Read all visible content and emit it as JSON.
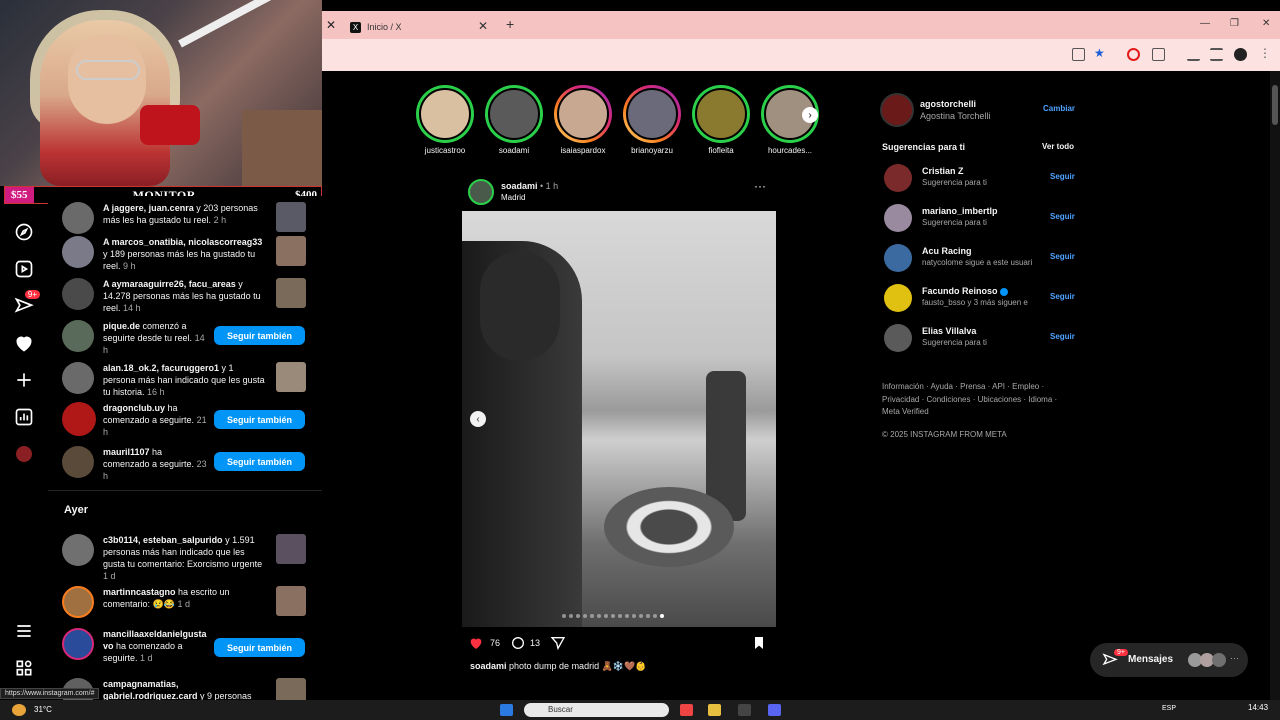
{
  "overlay": {
    "left_price": "$55",
    "title": "MONITOR",
    "right_price": "$400"
  },
  "nav_badge": "9+",
  "notifications": [
    {
      "user": "A jaggere, juan.cenra",
      "text": " y 203 personas más les ha gustado tu reel.",
      "time": " 2 h"
    },
    {
      "user": "A marcos_onatibia, nicolascorreag33",
      "text": " y 189 personas más les ha gustado tu reel.",
      "time": " 9 h"
    },
    {
      "user": "A aymaraaguirre26, facu_areas",
      "text": " y 14.278 personas más les ha gustado tu reel.",
      "time": " 14 h"
    },
    {
      "user": "pique.de",
      "text": " comenzó a seguirte desde tu reel.",
      "time": " 14 h"
    },
    {
      "user": "alan.18_ok.2, facuruggero1",
      "text": " y 1 persona más han indicado que les gusta tu historia.",
      "time": " 16 h"
    },
    {
      "user": "dragonclub.uy",
      "text": " ha comenzado a seguirte.",
      "time": " 21 h"
    },
    {
      "user": "mauril1107",
      "text": " ha comenzado a seguirte.",
      "time": " 23 h"
    }
  ],
  "follow_back_label": "Seguir también",
  "section_yesterday": "Ayer",
  "notifications_yesterday": [
    {
      "user": "c3b0114, esteban_salpurido",
      "text": " y 1.591 personas más han indicado que les gusta tu comentario: Exorcismo urgente",
      "time": " 1 d"
    },
    {
      "user": "martinncastagno",
      "text": " ha escrito un comentario: 😢😂",
      "time": " 1 d"
    },
    {
      "user": "mancillaaxeldanielgusta vo",
      "text": " ha comenzado a seguirte.",
      "time": " 1 d"
    },
    {
      "user": "campagnamatias, gabriel.rodriguez.card",
      "text": " y 9 personas",
      "time": ""
    }
  ],
  "browser": {
    "tab_title": "Inicio / X",
    "new_tab": "+"
  },
  "stories": [
    {
      "name": "justicastroo"
    },
    {
      "name": "soadami"
    },
    {
      "name": "isaiaspardox"
    },
    {
      "name": "brianoyarzu"
    },
    {
      "name": "fiofleita"
    },
    {
      "name": "hourcades..."
    }
  ],
  "post": {
    "username": "soadami",
    "time": " • 1 h",
    "location": "Madrid",
    "more": "···",
    "likes": "76",
    "comments": "13",
    "caption_user": "soadami",
    "caption_text": " photo dump de madrid ",
    "caption_emoji": "🧸❄️🤎👶",
    "carousel": {
      "count": 15,
      "active": 15
    }
  },
  "sidebar": {
    "me": {
      "username": "agostorchelli",
      "fullname": "Agostina Torchelli",
      "switch": "Cambiar"
    },
    "suggestions_title": "Sugerencias para ti",
    "see_all": "Ver todo",
    "follow_label": "Seguir",
    "suggestions": [
      {
        "username": "Cristian Z",
        "sub": "Sugerencia para ti",
        "verified": false
      },
      {
        "username": "mariano_imbertlp",
        "sub": "Sugerencia para ti",
        "verified": false
      },
      {
        "username": "Acu Racing",
        "sub": "natycolome sigue a este usuari",
        "verified": false
      },
      {
        "username": "Facundo Reinoso",
        "sub": "fausto_bsso y 3 más siguen e",
        "verified": true
      },
      {
        "username": "Elias Villalva",
        "sub": "Sugerencia para ti",
        "verified": false
      }
    ],
    "footer_line1": "Información · Ayuda · Prensa · API · Empleo ·",
    "footer_line2": "Privacidad · Condiciones · Ubicaciones · Idioma ·",
    "footer_line3": "Meta Verified",
    "copyright": "© 2025 INSTAGRAM FROM META"
  },
  "messages": {
    "label": "Mensajes",
    "badge": "9+"
  },
  "status_url": "https://www.instagram.com/#",
  "taskbar": {
    "temp": "31°C",
    "search": "Buscar",
    "lang": "ESP",
    "clock": "14:43"
  }
}
